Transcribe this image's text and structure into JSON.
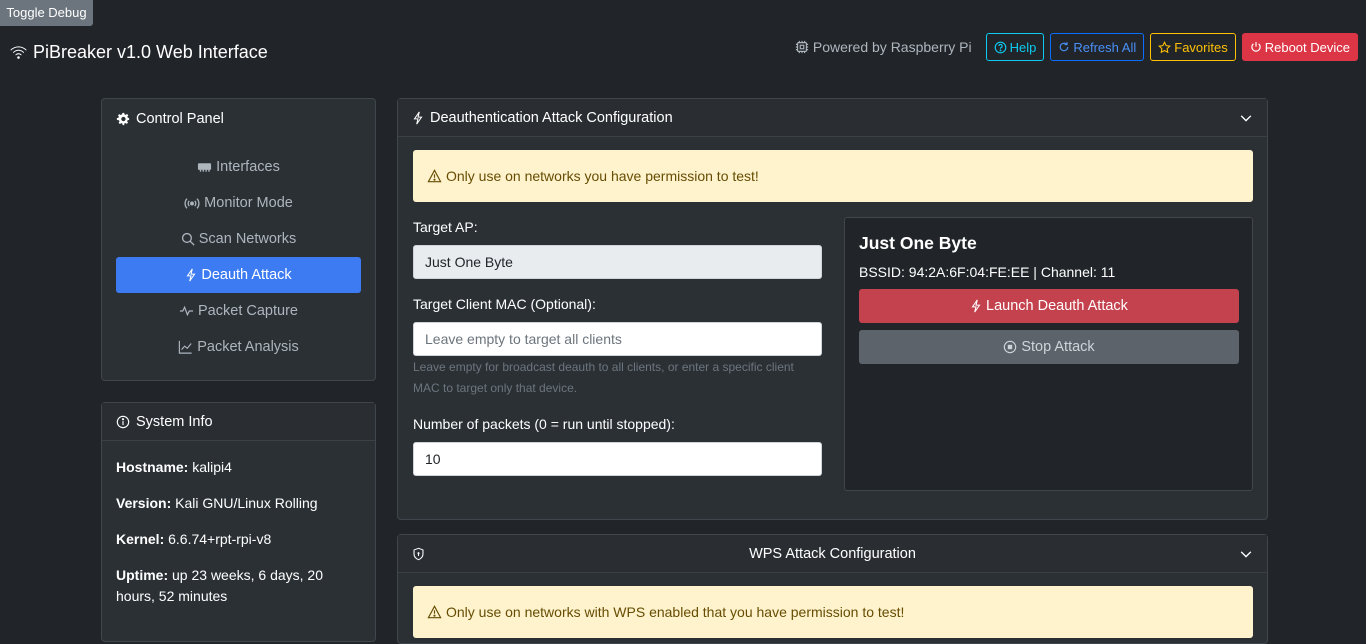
{
  "debug": {
    "label": "Toggle Debug"
  },
  "header": {
    "title": "PiBreaker v1.0 Web Interface",
    "powered": "Powered by Raspberry Pi",
    "buttons": {
      "help": "Help",
      "refresh": "Refresh All",
      "favorites": "Favorites",
      "reboot": "Reboot Device"
    },
    "colors": {
      "help": "#0dcaf0",
      "refresh": "#0d6efd",
      "favorites": "#ffc107",
      "reboot": "#dc3545"
    }
  },
  "control_panel": {
    "title": "Control Panel",
    "items": [
      {
        "label": "Interfaces",
        "icon": "ethernet-icon",
        "active": false
      },
      {
        "label": "Monitor Mode",
        "icon": "broadcast-icon",
        "active": false
      },
      {
        "label": "Scan Networks",
        "icon": "search-icon",
        "active": false
      },
      {
        "label": "Deauth Attack",
        "icon": "lightning-icon",
        "active": true
      },
      {
        "label": "Packet Capture",
        "icon": "pulse-icon",
        "active": false
      },
      {
        "label": "Packet Analysis",
        "icon": "graph-icon",
        "active": false
      }
    ]
  },
  "system_info": {
    "title": "System Info",
    "hostname_label": "Hostname:",
    "hostname": "kalipi4",
    "version_label": "Version:",
    "version": "Kali GNU/Linux Rolling",
    "kernel_label": "Kernel:",
    "kernel": "6.6.74+rpt-rpi-v8",
    "uptime_label": "Uptime:",
    "uptime": "up 23 weeks, 6 days, 20 hours, 52 minutes"
  },
  "deauth": {
    "title": "Deauthentication Attack Configuration",
    "warning": "Only use on networks you have permission to test!",
    "target_ap_label": "Target AP:",
    "target_ap_value": "Just One Byte",
    "client_label": "Target Client MAC (Optional):",
    "client_placeholder": "Leave empty to target all clients",
    "client_help": "Leave empty for broadcast deauth to all clients, or enter a specific client MAC to target only that device.",
    "packets_label": "Number of packets (0 = run until stopped):",
    "packets_value": "10",
    "target": {
      "name": "Just One Byte",
      "details": "BSSID: 94:2A:6F:04:FE:EE | Channel: 11"
    },
    "launch_label": "Launch Deauth Attack",
    "stop_label": "Stop Attack"
  },
  "wps": {
    "title": "WPS Attack Configuration",
    "warning": "Only use on networks with WPS enabled that you have permission to test!"
  }
}
